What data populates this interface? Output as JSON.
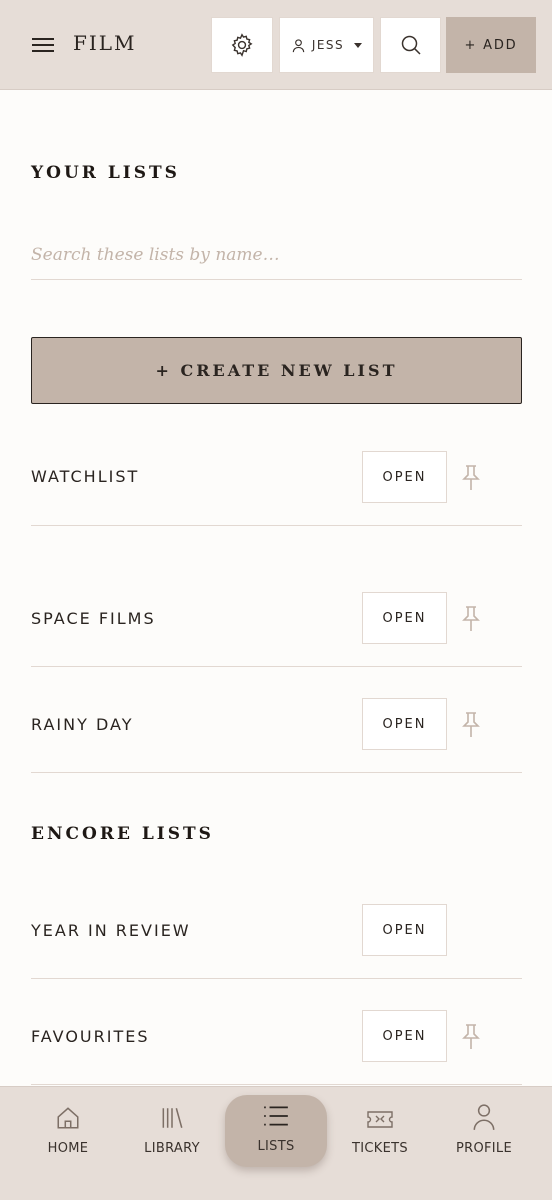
{
  "header": {
    "app_title": "FILM",
    "user_label": "JESS",
    "add_label": "+ ADD"
  },
  "your_lists": {
    "title": "YOUR LISTS",
    "search_placeholder": "Search these lists by name…",
    "create_label": "+ CREATE NEW LIST",
    "items": [
      {
        "name": "WATCHLIST",
        "open_label": "OPEN",
        "pinned": true
      },
      {
        "name": "SPACE FILMS",
        "open_label": "OPEN",
        "pinned": true
      },
      {
        "name": "RAINY DAY",
        "open_label": "OPEN",
        "pinned": true
      }
    ]
  },
  "encore_lists": {
    "title": "ENCORE LISTS",
    "items": [
      {
        "name": "YEAR IN REVIEW",
        "open_label": "OPEN",
        "pinned": false
      },
      {
        "name": "FAVOURITES",
        "open_label": "OPEN",
        "pinned": true
      }
    ]
  },
  "bottom_nav": {
    "items": [
      {
        "label": "HOME",
        "icon": "home-icon",
        "active": false
      },
      {
        "label": "LIBRARY",
        "icon": "library-icon",
        "active": false
      },
      {
        "label": "LISTS",
        "icon": "list-icon",
        "active": true
      },
      {
        "label": "TICKETS",
        "icon": "ticket-icon",
        "active": false
      },
      {
        "label": "PROFILE",
        "icon": "profile-icon",
        "active": false
      }
    ]
  },
  "colors": {
    "header_bg": "#e6ddd7",
    "accent": "#c3b4a9",
    "text": "#2a2420",
    "divider": "#e2d8d1",
    "page_bg": "#fdfcfa"
  }
}
